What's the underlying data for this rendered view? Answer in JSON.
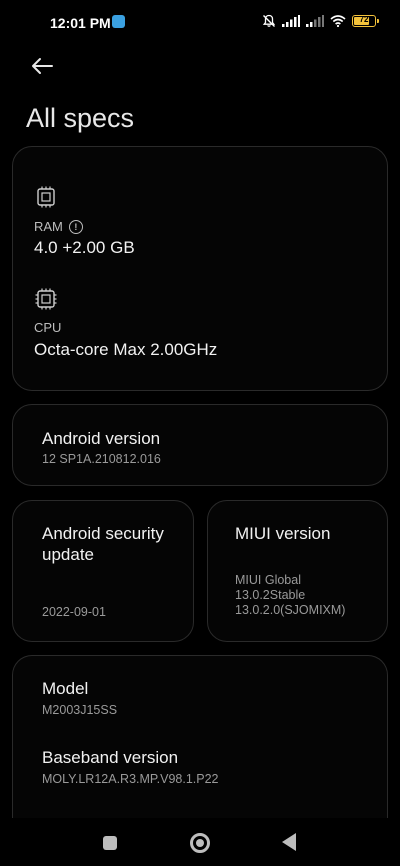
{
  "status": {
    "time": "12:01 PM",
    "battery": "72"
  },
  "header": {
    "title": "All specs"
  },
  "specs": {
    "ram": {
      "label": "RAM",
      "value": "4.0 +2.00 GB"
    },
    "cpu": {
      "label": "CPU",
      "value": "Octa-core Max 2.00GHz"
    }
  },
  "android": {
    "label": "Android version",
    "value": "12 SP1A.210812.016"
  },
  "security": {
    "label_line1": "Android security",
    "label_line2": "update",
    "value": "2022-09-01"
  },
  "miui": {
    "label": "MIUI version",
    "line1": "MIUI Global",
    "line2": "13.0.2Stable",
    "line3": "13.0.2.0(SJOMIXM)"
  },
  "model": {
    "label": "Model",
    "value": "M2003J15SS"
  },
  "baseband": {
    "label": "Baseband version",
    "value": "MOLY.LR12A.R3.MP.V98.1.P22"
  }
}
